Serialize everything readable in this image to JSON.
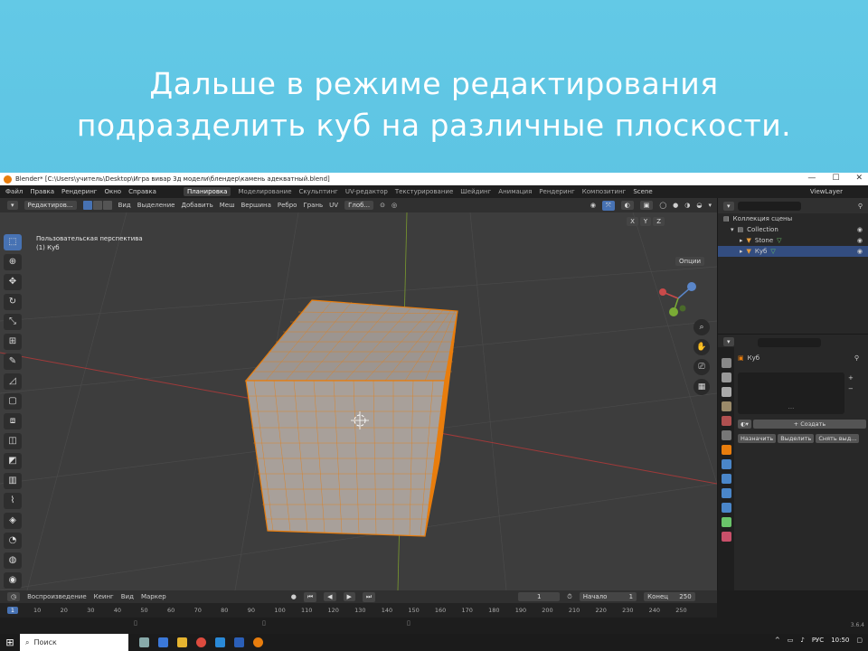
{
  "slide": {
    "title_line1": "Дальше в режиме редактирования",
    "title_line2": "подразделить куб на различные плоскости."
  },
  "window": {
    "title": "Blender* [C:\\Users\\учитель\\Desktop\\Игра вивар 3д модели\\блендер\\камень адекватный.blend]",
    "minimize": "—",
    "maximize": "☐",
    "close": "✕"
  },
  "menu": {
    "items": [
      "Файл",
      "Правка",
      "Рендеринг",
      "Окно",
      "Справка"
    ],
    "workspaces": [
      "Планировка",
      "Моделирование",
      "Скульптинг",
      "UV-редактор",
      "Текстурирование",
      "Шейдинг",
      "Анимация",
      "Рендеринг",
      "Композитинг"
    ],
    "active_workspace": "Планировка",
    "scene_label": "Scene",
    "view_layer_label": "ViewLayer"
  },
  "viewport_header": {
    "mode": "Редактиров...",
    "menus": [
      "Вид",
      "Выделение",
      "Добавить",
      "Меш",
      "Вершина",
      "Ребро",
      "Грань",
      "UV"
    ],
    "transform": "Глоб...",
    "axes": [
      "X",
      "Y",
      "Z"
    ],
    "options": "Опции"
  },
  "viewport": {
    "perspective_label": "Пользовательская перспектива",
    "object_label": "(1) Куб"
  },
  "tools": {
    "icons": [
      "select-icon",
      "cursor-icon",
      "move-icon",
      "rotate-icon",
      "scale-icon",
      "transform-icon",
      "annotate-icon",
      "measure-icon",
      "add-cube-icon",
      "extrude-icon",
      "inset-icon",
      "bevel-icon",
      "loopcut-icon",
      "knife-icon",
      "polybuild-icon",
      "spin-icon",
      "smooth-icon",
      "shrink-icon",
      "shear-icon"
    ]
  },
  "outliner": {
    "root": "Коллекция сцены",
    "collection": "Collection",
    "items": [
      {
        "name": "Stone",
        "selected": false
      },
      {
        "name": "Куб",
        "selected": true
      }
    ]
  },
  "properties": {
    "object_name": "Куб",
    "create_label": "Создать",
    "assign_label": "Назначить",
    "select_label": "Выделить",
    "deselect_label": "Снять выд...",
    "dots": "...",
    "plus": "+",
    "minus": "−"
  },
  "timeline": {
    "menus": [
      "Воспроизведение",
      "Кеинг",
      "Вид",
      "Маркер"
    ],
    "current_frame": "1",
    "start_label": "Начало",
    "start_value": "1",
    "end_label": "Конец",
    "end_value": "250",
    "ruler": [
      "1",
      "10",
      "20",
      "30",
      "40",
      "50",
      "60",
      "70",
      "80",
      "90",
      "100",
      "110",
      "120",
      "130",
      "140",
      "150",
      "160",
      "170",
      "180",
      "190",
      "200",
      "210",
      "220",
      "230",
      "240",
      "250"
    ],
    "version": "3.6.4"
  },
  "taskbar": {
    "search_placeholder": "Поиск",
    "lang": "РУС",
    "time": "10:50"
  },
  "colors": {
    "accent": "#4772b3",
    "edit_orange": "#e87d0d",
    "slide_bg": "#5dc3e3"
  }
}
